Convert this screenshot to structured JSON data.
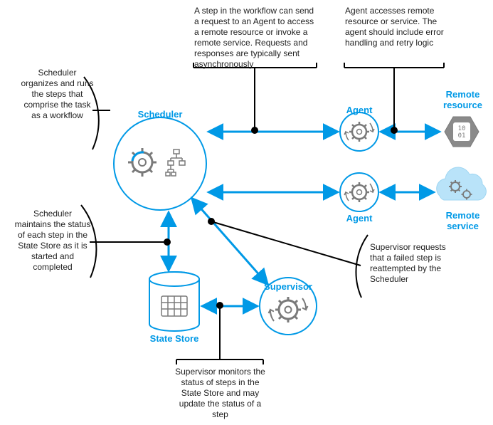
{
  "nodes": {
    "scheduler": "Scheduler",
    "state_store": "State Store",
    "supervisor": "Supervisor",
    "agent_top": "Agent",
    "agent_bottom": "Agent",
    "remote_resource": "Remote\nresource",
    "remote_service": "Remote\nservice"
  },
  "annotations": {
    "scheduler_workflow": "Scheduler organizes and runs the steps that comprise the task as a workflow",
    "step_request": "A step in the workflow can send a request to an Agent to access a remote resource or invoke a remote service. Requests and responses are typically sent asynchronously",
    "agent_access": "Agent accesses remote resource or service. The agent should include error handling and retry logic",
    "scheduler_maintains": "Scheduler maintains the status of each step in the State Store as it is started and completed",
    "supervisor_requests": "Supervisor requests that a failed step is reattempted by the Scheduler",
    "supervisor_monitors": "Supervisor monitors the status of steps in the State Store and may update the status of a step"
  },
  "colors": {
    "blue": "#0099e6",
    "gray": "#7a7a7a",
    "black": "#000000"
  }
}
